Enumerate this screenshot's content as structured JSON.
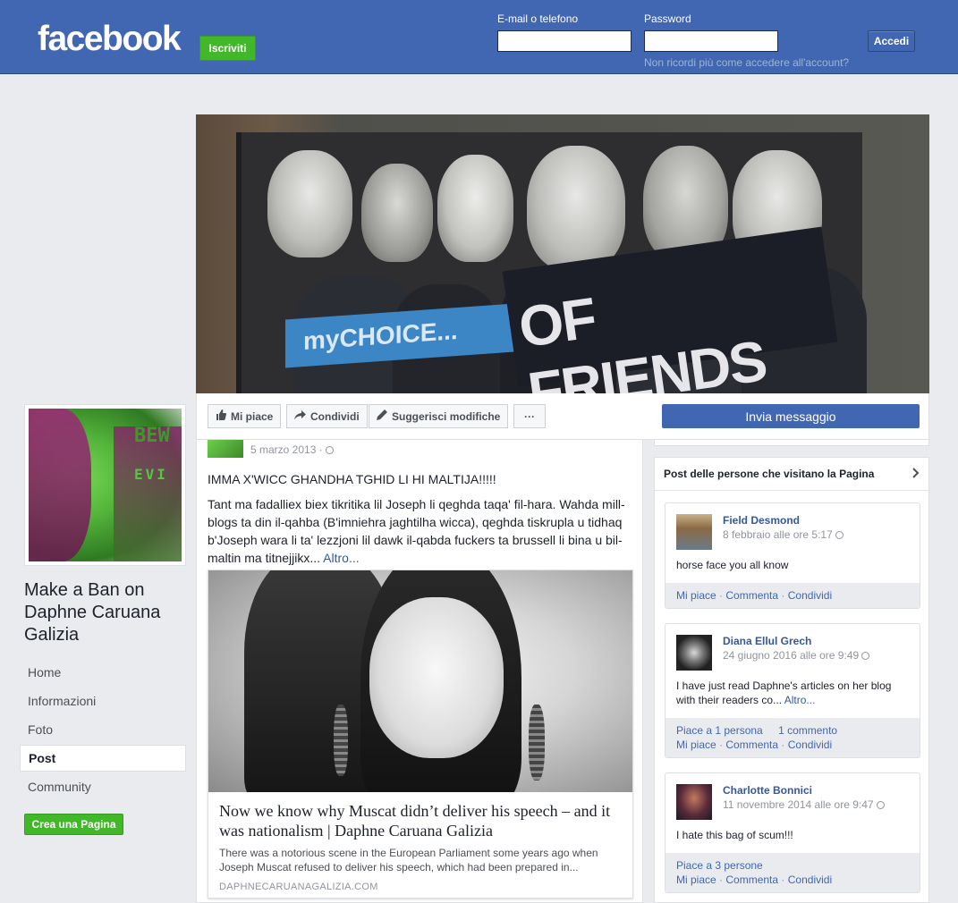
{
  "topbar": {
    "logo": "facebook",
    "signup_label": "Iscriviti",
    "email_label": "E-mail o telefono",
    "password_label": "Password",
    "login_label": "Accedi",
    "forgot_label": "Non ricordi più come accedere all'account?"
  },
  "cover": {
    "sign_text_1": "myCHOICE...",
    "sign_text_2": "OF FRIENDS"
  },
  "actions": {
    "like": "Mi piace",
    "share": "Condividi",
    "suggest": "Suggerisci modifiche",
    "more": "···",
    "message": "Invia messaggio"
  },
  "profile": {
    "badge_1": "BEW",
    "badge_2": "EVI",
    "name": "Make a Ban on Daphne Caruana Galizia"
  },
  "nav": {
    "items": [
      "Home",
      "Informazioni",
      "Foto",
      "Post",
      "Community"
    ],
    "create_page": "Crea una Pagina"
  },
  "post": {
    "date": "5 marzo 2013 · ",
    "heading": "IMMA X'WICC GHANDHA TGHID LI HI MALTIJA!!!!!",
    "body": "Tant ma fadalliex biex tikritika lil Joseph li qeghda taqa' fil-hara. Wahda mill-blogs ta din il-qahba (B'imniehra jaghtilha wicca), qeghda tiskrupla u tidhaq b'Joseph wara li ta' lezzjoni lil dawk il-qabda fuckers ta brussell li bina u bil-maltin ma titnejjikx...",
    "more": "Altro...",
    "link": {
      "title": "Now we know why Muscat didn’t deliver his speech – and it was nationalism | Daphne Caruana Galizia",
      "description": "There was a notorious scene in the European Parliament some years ago when Joseph Muscat refused to deliver his speech, which had been prepared in...",
      "domain": "DAPHNECARUANAGALIZIA.COM"
    }
  },
  "visitors": {
    "header": "Post delle persone che visitano la Pagina",
    "cards": [
      {
        "name": "Field Desmond",
        "date": "8 febbraio alle ore 5:17 ",
        "text": "horse face you all know",
        "more": "",
        "stats": "",
        "stats2": "",
        "like": "Mi piace",
        "comment": "Commenta",
        "share": "Condividi"
      },
      {
        "name": "Diana Ellul Grech",
        "date": "24 giugno 2016 alle ore 9:49 ",
        "text": "I have just read Daphne's articles on her blog with their readers co...",
        "more": "Altro...",
        "stats": "Piace a 1 persona",
        "stats2": "1 commento",
        "like": "Mi piace",
        "comment": "Commenta",
        "share": "Condividi"
      },
      {
        "name": "Charlotte Bonnici",
        "date": "11 novembre 2014 alle ore 9:47 ",
        "text": "I hate this bag of scum!!!",
        "more": "",
        "stats": "Piace a 3 persone",
        "stats2": "",
        "like": "Mi piace",
        "comment": "Commenta",
        "share": "Condividi"
      }
    ]
  },
  "colors": {
    "brand_blue": "#4267b2",
    "green": "#42b72a",
    "background": "#e9ebee"
  },
  "icons": [
    "thumbs-up-icon",
    "share-arrow-icon",
    "pencil-icon",
    "more-icon",
    "globe-icon",
    "chevron-right-icon"
  ]
}
